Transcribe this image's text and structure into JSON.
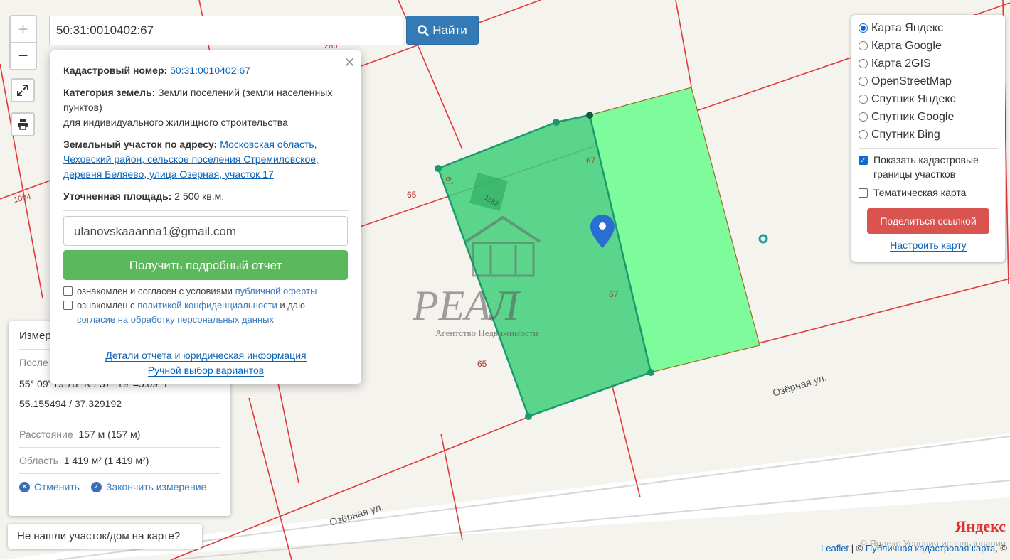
{
  "search": {
    "value": "50:31:0010402:67",
    "button": "Найти"
  },
  "zoom": {
    "in": "+",
    "out": "−"
  },
  "popup": {
    "close": "×",
    "cadastral_label": "Кадастровый номер:",
    "cadastral_value": "50:31:0010402:67",
    "category_label": "Категория земель:",
    "category_value": "Земли поселений (земли населенных пунктов)",
    "category_use": "для индивидуального жилищного строительства",
    "address_label": "Земельный участок по адресу:",
    "address_value": "Московская область, Чеховский район, сельское поселения Стремиловское, деревня Беляево, улица Озерная, участок 17",
    "area_label": "Уточненная площадь:",
    "area_value": "2 500 кв.м.",
    "email": "ulanovskaaanna1@gmail.com",
    "report_button": "Получить подробный отчет",
    "check1_text": "ознакомлен и согласен с условиями",
    "check1_link": "публичной оферты",
    "check2_text": "ознакомлен с",
    "check2_link": "политикой конфиденциальности",
    "check2_tail": "и даю",
    "check2_link2": "согласие на обработку персональных данных",
    "link_details": "Детали отчета и юридическая информация",
    "link_manual": "Ручной выбор вариантов"
  },
  "measure": {
    "title": "Измер",
    "last_label": "После",
    "coords_dms": "55° 09' 19.78\" N / 37° 19' 45.09\" E",
    "coords_dec": "55.155494 / 37.329192",
    "distance_label": "Расстояние",
    "distance_value": "157 м (157 м)",
    "area_label": "Область",
    "area_value": "1 419 м² (1 419 м²)",
    "cancel": "Отменить",
    "finish": "Закончить измерение"
  },
  "notfound": "Не нашли участок/дом на карте?",
  "layers": {
    "items": [
      {
        "label": "Карта Яндекс",
        "selected": true
      },
      {
        "label": "Карта Google",
        "selected": false
      },
      {
        "label": "Карта 2GIS",
        "selected": false
      },
      {
        "label": "OpenStreetMap",
        "selected": false
      },
      {
        "label": "Спутник Яндекс",
        "selected": false
      },
      {
        "label": "Спутник Google",
        "selected": false
      },
      {
        "label": "Спутник Bing",
        "selected": false
      }
    ],
    "show_borders": "Показать кадастровые границы участков",
    "show_borders_checked": true,
    "thematic": "Тематическая карта",
    "thematic_checked": false,
    "share": "Поделиться ссылкой",
    "configure": "Настроить карту"
  },
  "map": {
    "labels": [
      "286",
      "1094",
      "65",
      "65",
      "67",
      "67",
      "67",
      "1182"
    ],
    "street1": "Озёрная ул.",
    "street2": "Озёрная ул.",
    "watermark_title": "РЕАЛ",
    "watermark_sub": "Агентство Недвижимости"
  },
  "brand": "Яндекс",
  "attribution": {
    "leaflet": "Leaflet",
    "sep": "| ©",
    "pkk": "Публичная кадастровая карта",
    "tail": ", ©",
    "faded": "© Яндекс  Условия использования"
  },
  "colors": {
    "primary": "#337ab7",
    "success": "#5cb85c",
    "danger": "#d9534f",
    "parcel": "#7efc9c",
    "parcel_selected": "#3fcf7a"
  }
}
